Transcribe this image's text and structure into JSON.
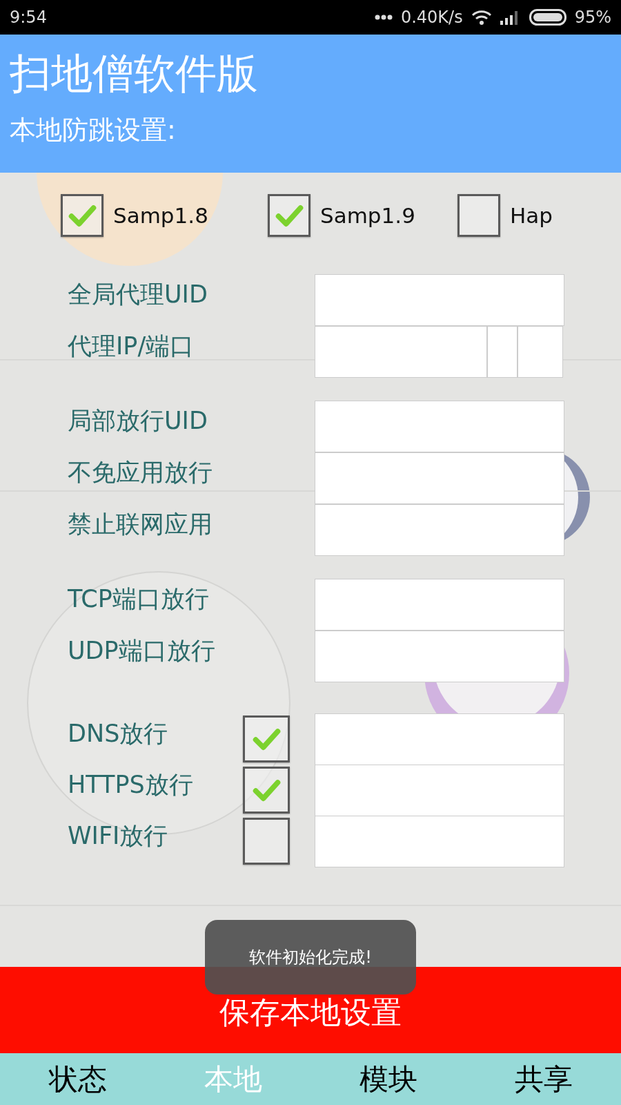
{
  "status_bar": {
    "time": "9:54",
    "speed": "0.40K/s",
    "battery": "95%"
  },
  "app_bar": {
    "title": "扫地僧软件版",
    "subtitle": "本地防跳设置:"
  },
  "versions": [
    {
      "label": "Samp1.8",
      "checked": true
    },
    {
      "label": "Samp1.9",
      "checked": true
    },
    {
      "label": "Hap",
      "checked": false
    }
  ],
  "groups": [
    {
      "rows": [
        {
          "label": "全局代理UID",
          "kind": "field"
        },
        {
          "label": "代理IP/端口",
          "kind": "ip_port"
        }
      ]
    },
    {
      "rows": [
        {
          "label": "局部放行UID",
          "kind": "field"
        },
        {
          "label": "不免应用放行",
          "kind": "field"
        },
        {
          "label": "禁止联网应用",
          "kind": "field"
        }
      ]
    },
    {
      "rows": [
        {
          "label": "TCP端口放行",
          "kind": "field"
        },
        {
          "label": "UDP端口放行",
          "kind": "field"
        }
      ]
    },
    {
      "rows": [
        {
          "label": "DNS放行",
          "kind": "check_field",
          "checked": true
        },
        {
          "label": "HTTPS放行",
          "kind": "check_field",
          "checked": true
        },
        {
          "label": "WIFI放行",
          "kind": "check_field",
          "checked": false
        }
      ]
    }
  ],
  "toast": "软件初始化完成!",
  "save_button": "保存本地设置",
  "tabs": [
    {
      "label": "状态",
      "selected": false
    },
    {
      "label": "本地",
      "selected": true
    },
    {
      "label": "模块",
      "selected": false
    },
    {
      "label": "共享",
      "selected": false
    }
  ]
}
